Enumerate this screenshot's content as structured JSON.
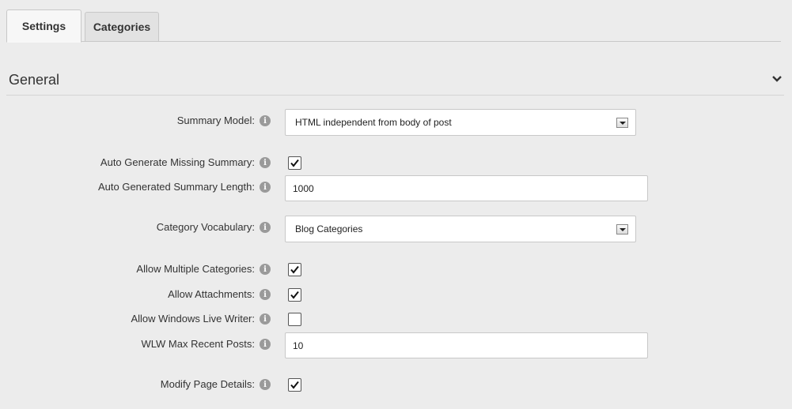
{
  "tabs": [
    {
      "label": "Settings",
      "active": true
    },
    {
      "label": "Categories",
      "active": false
    }
  ],
  "section": {
    "title": "General",
    "collapse_icon": "chevron-down-icon"
  },
  "fields": {
    "summary_model": {
      "label": "Summary Model:",
      "value": "HTML independent from body of post"
    },
    "auto_generate_missing_summary": {
      "label": "Auto Generate Missing Summary:",
      "checked": true
    },
    "auto_generated_summary_length": {
      "label": "Auto Generated Summary Length:",
      "value": "1000"
    },
    "category_vocabulary": {
      "label": "Category Vocabulary:",
      "value": "Blog Categories"
    },
    "allow_multiple_categories": {
      "label": "Allow Multiple Categories:",
      "checked": true
    },
    "allow_attachments": {
      "label": "Allow Attachments:",
      "checked": true
    },
    "allow_windows_live_writer": {
      "label": "Allow Windows Live Writer:",
      "checked": false
    },
    "wlw_max_recent_posts": {
      "label": "WLW Max Recent Posts:",
      "value": "10"
    },
    "modify_page_details": {
      "label": "Modify Page Details:",
      "checked": true
    }
  },
  "info_icon": "info-icon",
  "colors": {
    "background": "#ececec",
    "info_icon": "#9a9a9a",
    "border": "#c8c8c8"
  }
}
